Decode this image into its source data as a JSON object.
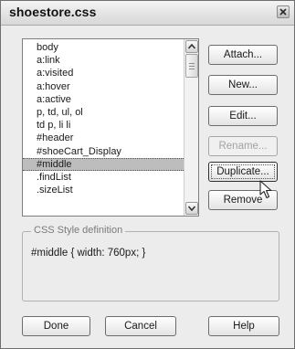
{
  "window": {
    "title": "shoestore.css",
    "colors": {
      "background": "#ececec",
      "selection": "#bdbdbd",
      "disabled_text": "#a3a3a3"
    }
  },
  "style_list": {
    "items": [
      "body",
      "a:link",
      "a:visited",
      "a:hover",
      "a:active",
      "p, td, ul, ol",
      "td p, li li",
      "#header",
      "#shoeCart_Display",
      "#middle",
      ".findList",
      ".sizeList"
    ],
    "selected": "#middle"
  },
  "side_buttons": {
    "attach": "Attach...",
    "new": "New...",
    "edit": "Edit...",
    "rename": "Rename...",
    "duplicate": "Duplicate...",
    "remove": "Remove"
  },
  "definition": {
    "legend": "CSS Style definition",
    "text": "#middle { width: 760px; }"
  },
  "bottom_buttons": {
    "done": "Done",
    "cancel": "Cancel",
    "help": "Help"
  },
  "icons": {
    "close": "close-icon",
    "scroll_up": "scroll-up-arrow-icon",
    "scroll_down": "scroll-down-arrow-icon",
    "pointer": "mouse-pointer-icon"
  }
}
